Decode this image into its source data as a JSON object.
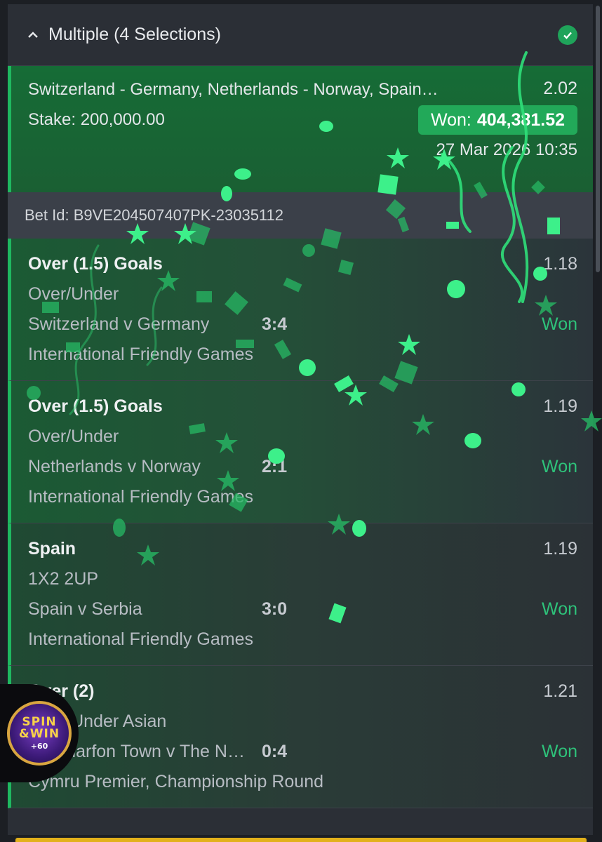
{
  "header": {
    "title": "Multiple (4 Selections)"
  },
  "summary": {
    "teams": "Switzerland - Germany, Netherlands - Norway, Spain…",
    "total_odds": "2.02",
    "stake": "Stake: 200,000.00",
    "won_label": "Won:",
    "won_amount": "404,381.52",
    "date": "27 Mar 2026 10:35"
  },
  "bet_id": "Bet Id: B9VE204507407PK-23035112",
  "selections": [
    {
      "pick": "Over (1.5) Goals",
      "market": "Over/Under",
      "event": "Switzerland v Germany",
      "score": "3:4",
      "league": "International Friendly Games",
      "odds": "1.18",
      "status": "Won"
    },
    {
      "pick": "Over (1.5) Goals",
      "market": "Over/Under",
      "event": "Netherlands v Norway",
      "score": "2:1",
      "league": "International Friendly Games",
      "odds": "1.19",
      "status": "Won"
    },
    {
      "pick": "Spain",
      "market": "1X2 2UP",
      "event": "Spain v Serbia",
      "score": "3:0",
      "league": "International Friendly Games",
      "odds": "1.19",
      "status": "Won"
    },
    {
      "pick": "Over (2)",
      "market": "Over/Under Asian",
      "event": "Caernarfon Town v The N…",
      "score": "0:4",
      "league": "Cymru Premier, Championship Round",
      "odds": "1.21",
      "status": "Won"
    }
  ],
  "badge": {
    "line1": "SPIN",
    "line2": "&WIN",
    "line3": "+60"
  },
  "colors": {
    "accent": "#1fb860",
    "won_pill": "#22a959",
    "won_text": "#2ec27a",
    "panel": "#2b2f36"
  }
}
